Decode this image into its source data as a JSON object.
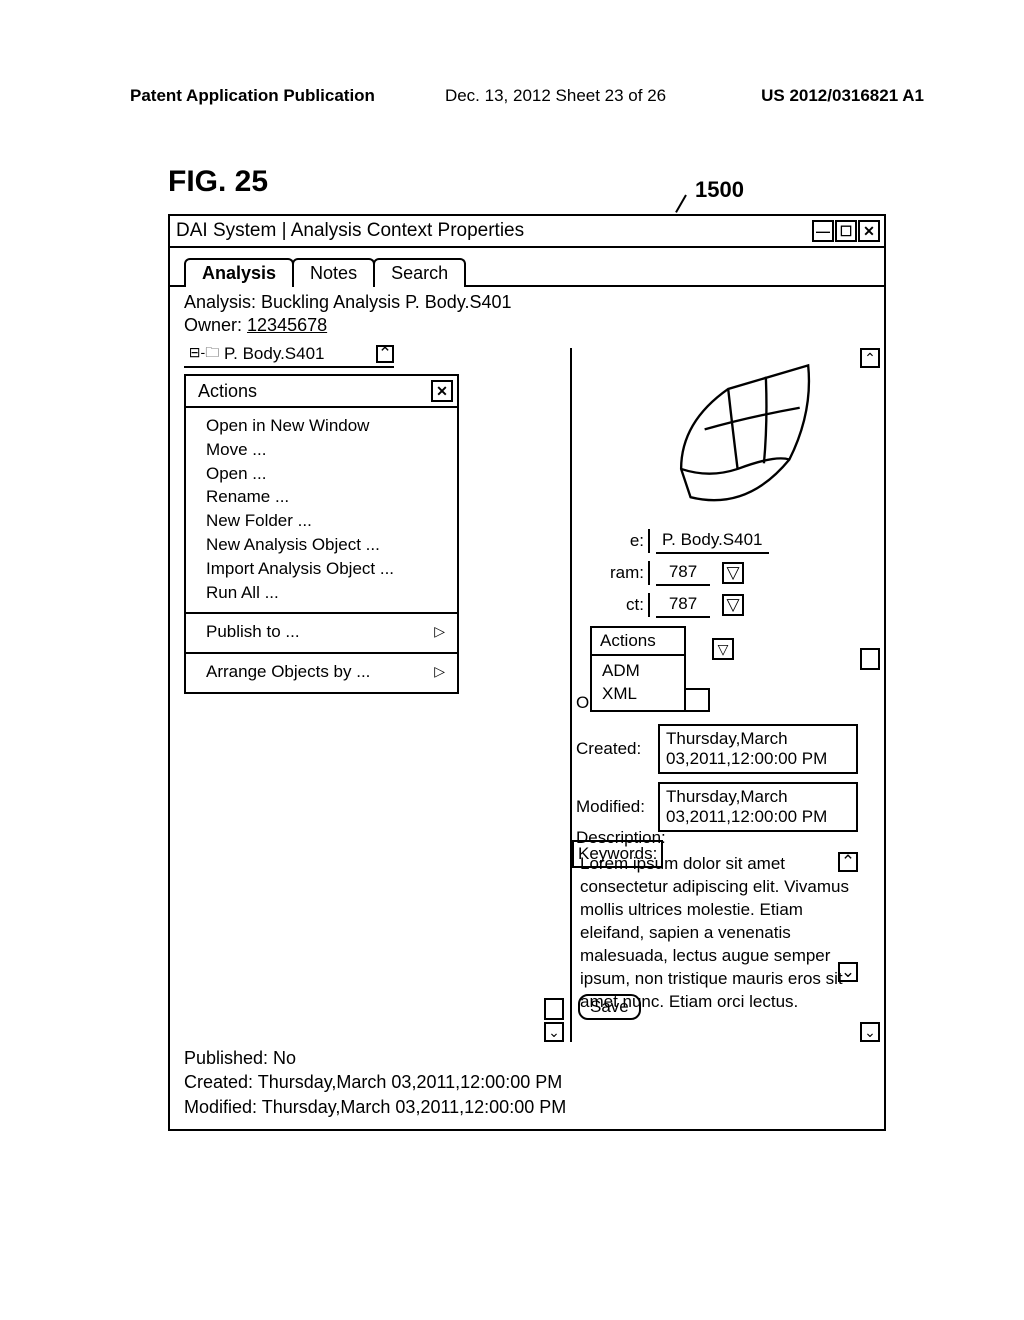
{
  "doc_header": {
    "left": "Patent Application Publication",
    "center": "Dec. 13, 2012  Sheet 23 of 26",
    "right": "US 2012/0316821 A1"
  },
  "fig_label": "FIG. 25",
  "callout": "1500",
  "titlebar": "DAI System | Analysis Context Properties",
  "tabs": [
    "Analysis",
    "Notes",
    "Search"
  ],
  "analysis_info": {
    "line1": "Analysis: Buckling Analysis P. Body.S401",
    "owner_label": "Owner: ",
    "owner_value": "12345678"
  },
  "tree_item": "P. Body.S401",
  "actions_menu": {
    "title": "Actions",
    "groups": [
      [
        "Open in New Window",
        "Move ...",
        "Open ...",
        "Rename ...",
        "New Folder ...",
        "New Analysis Object ...",
        "Import Analysis Object ...",
        "Run All ..."
      ],
      [
        "Publish to ..."
      ],
      [
        "Arrange Objects by ..."
      ]
    ]
  },
  "fields": {
    "name": {
      "label_partial": "e:",
      "value": "P. Body.S401"
    },
    "program": {
      "label_partial": "ram:",
      "value": "787"
    },
    "project": {
      "label_partial": "ct:",
      "value": "787"
    }
  },
  "actions_popup": {
    "title": "Actions",
    "items": [
      "ADM",
      "XML"
    ]
  },
  "orphan_o": "O",
  "meta": {
    "created_label": "Created:",
    "created_value": "Thursday,March 03,2011,12:00:00 PM",
    "modified_label": "Modified:",
    "modified_value": "Thursday,March 03,2011,12:00:00 PM",
    "keywords_label": "Keywords:"
  },
  "description": {
    "label": "Description:",
    "text": "Lorem ipsum dolor sit amet consectetur adipiscing elit. Vivamus mollis ultrices molestie. Etiam eleifand, sapien a venenatis malesuada, lectus augue semper ipsum, non tristique mauris eros sit amet nunc. Etiam orci lectus."
  },
  "save_label": "Save",
  "footer": {
    "published": "Published: No",
    "created": "Created: Thursday,March 03,2011,12:00:00 PM",
    "modified": "Modified: Thursday,March 03,2011,12:00:00 PM"
  },
  "glyphs": {
    "min": "—",
    "max": "☐",
    "close": "✕",
    "up": "⌃",
    "down": "⌄",
    "tri_down": "▽",
    "tri_right": "▷"
  }
}
